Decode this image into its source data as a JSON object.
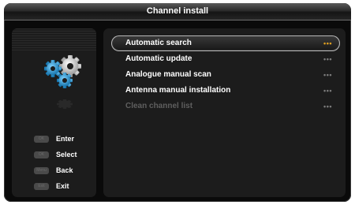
{
  "window": {
    "title": "Channel install"
  },
  "legend": [
    {
      "key": "OK",
      "label": "Enter"
    },
    {
      "key": "OK",
      "label": "Select"
    },
    {
      "key": "Menu",
      "label": "Back"
    },
    {
      "key": "Exit",
      "label": "Exit"
    }
  ],
  "menu": {
    "items": [
      {
        "label": "Automatic search",
        "more": "•••",
        "selected": true,
        "enabled": true
      },
      {
        "label": "Automatic update",
        "more": "•••",
        "selected": false,
        "enabled": true
      },
      {
        "label": "Analogue manual scan",
        "more": "•••",
        "selected": false,
        "enabled": true
      },
      {
        "label": "Antenna manual installation",
        "more": "•••",
        "selected": false,
        "enabled": true
      },
      {
        "label": "Clean channel list",
        "more": "•••",
        "selected": false,
        "enabled": false
      }
    ]
  },
  "colors": {
    "accent": "#e0a020",
    "gear_white": "#e6e6e6",
    "gear_blue": "#2a9fd8",
    "disabled": "#5f5f5f"
  },
  "icons": [
    "gears-icon"
  ]
}
